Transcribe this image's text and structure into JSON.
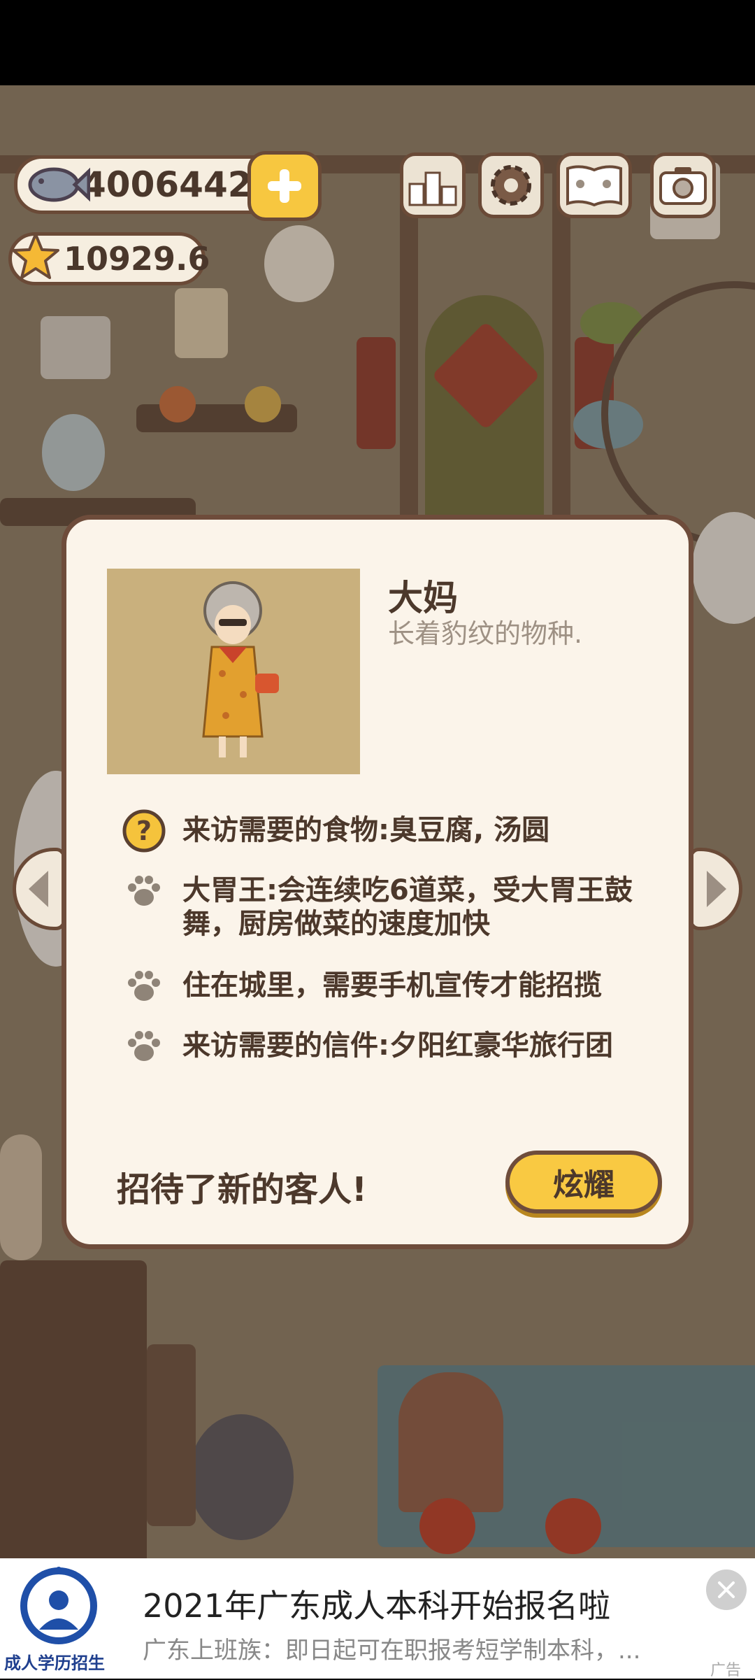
{
  "hud": {
    "fish_count": "4006442",
    "star_count": "10929.6",
    "icons": [
      "fish-icon",
      "star-icon",
      "plus-icon",
      "ranking-icon",
      "settings-gear-icon",
      "paw-book-icon",
      "camera-icon"
    ]
  },
  "dialog": {
    "name": "大妈",
    "description": "长着豹纹的物种.",
    "traits": [
      {
        "icon": "question-icon",
        "text": "来访需要的食物:臭豆腐, 汤圆"
      },
      {
        "icon": "paw-icon",
        "text": "大胃王:会连续吃6道菜，受大胃王鼓舞，厨房做菜的速度加快"
      },
      {
        "icon": "paw-icon",
        "text": "住在城里，需要手机宣传才能招揽"
      },
      {
        "icon": "paw-icon",
        "text": "来访需要的信件:夕阳红豪华旅行团"
      }
    ],
    "footer_message": "招待了新的客人!",
    "share_label": "炫耀"
  },
  "ad": {
    "logo_text": "成人学历招生",
    "title": "2021年广东成人本科开始报名啦",
    "subtitle": "广东上班族：即日起可在职报考短学制本科，...",
    "tag": "广告"
  },
  "colors": {
    "panel_bg": "#fbf4ea",
    "panel_border": "#6e4c3b",
    "button_yellow": "#f9c942",
    "text_dark": "#4c382b",
    "text_muted": "#9e9184"
  }
}
